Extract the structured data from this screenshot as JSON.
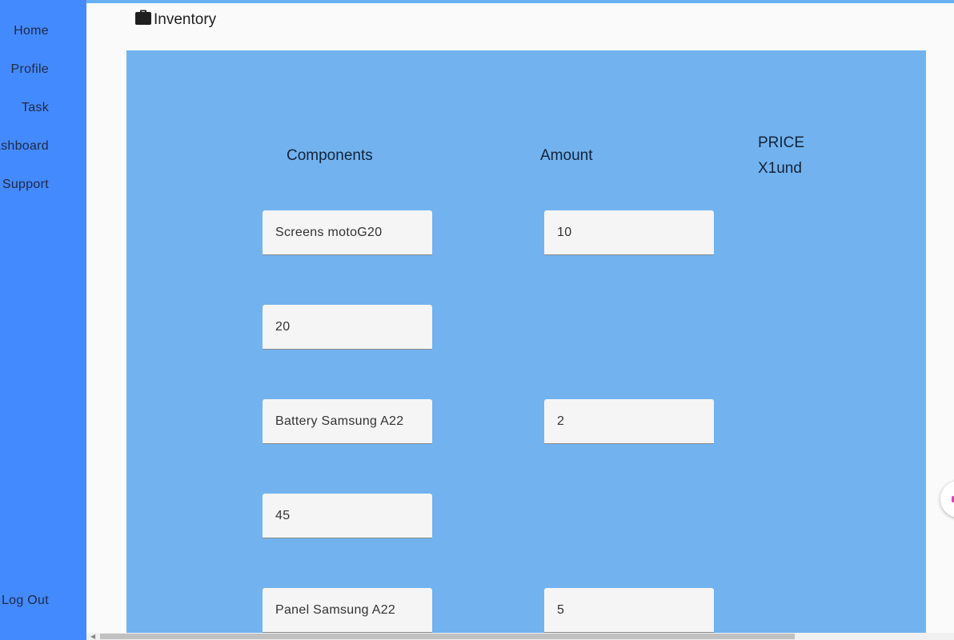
{
  "sidebar": {
    "items": [
      {
        "label": "Home"
      },
      {
        "label": "Profile"
      },
      {
        "label": "Task"
      },
      {
        "label": "Dashboard"
      },
      {
        "label": "Support"
      }
    ],
    "logout_label": "Log Out"
  },
  "header": {
    "icon": "briefcase-icon",
    "title": "Inventory"
  },
  "table": {
    "headers": {
      "components": "Components",
      "amount": "Amount",
      "price_line1": "PRICE",
      "price_line2": "X1und"
    },
    "rows": [
      {
        "component": "Screens motoG20",
        "amount": "10"
      },
      {
        "component": "20",
        "amount": null
      },
      {
        "component": "Battery Samsung A22",
        "amount": "2"
      },
      {
        "component": "45",
        "amount": null
      },
      {
        "component": "Panel Samsung A22",
        "amount": "5"
      }
    ]
  },
  "colors": {
    "sidebar": "#448aff",
    "panel": "#72b3ef",
    "field": "#f5f5f5",
    "accent": "#e040c0"
  }
}
